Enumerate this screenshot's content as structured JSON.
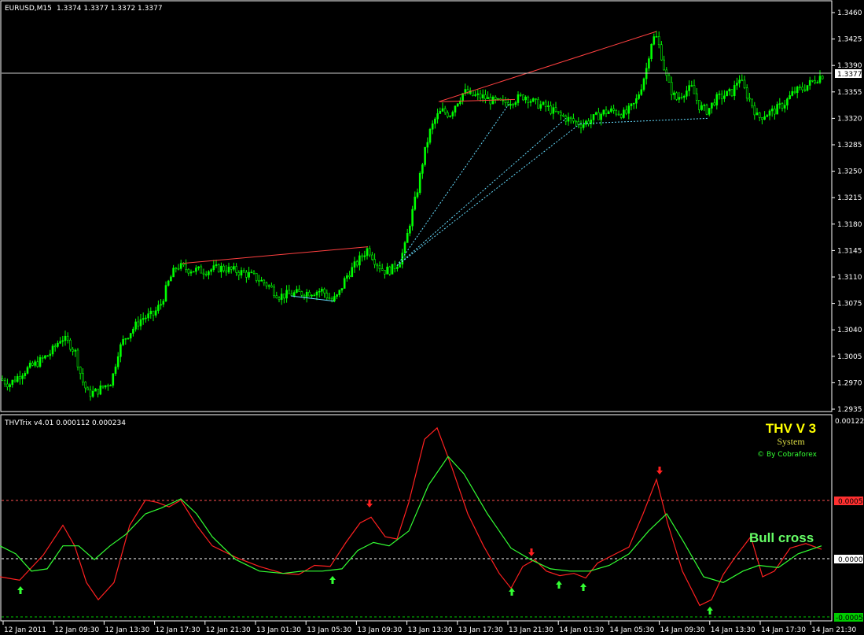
{
  "main": {
    "symbol_text": "EURUSD,M15",
    "ohlc_text": "1.3374 1.3377 1.3372 1.3377",
    "current_price": "1.3377",
    "price_ticks": [
      "1.3460",
      "1.3425",
      "1.3390",
      "1.3355",
      "1.3320",
      "1.3285",
      "1.3250",
      "1.3215",
      "1.3180",
      "1.3145",
      "1.3110",
      "1.3075",
      "1.3040",
      "1.3005",
      "1.2970",
      "1.2935"
    ]
  },
  "indicator": {
    "label": "THVTrix v4.01 0.000112 0.000234",
    "scale_top": "0.001224",
    "level_upper": "0.0005",
    "level_zero": "0.0000",
    "level_lower": "-0.0005",
    "brand_title": "THV V 3",
    "brand_sub": "System",
    "brand_credit": "© By Cobraforex",
    "annotation": "Bull cross"
  },
  "time_axis": [
    "12 Jan 2011",
    "12 Jan 09:30",
    "12 Jan 13:30",
    "12 Jan 17:30",
    "12 Jan 21:30",
    "13 Jan 01:30",
    "13 Jan 05:30",
    "13 Jan 09:30",
    "13 Jan 13:30",
    "13 Jan 17:30",
    "13 Jan 21:30",
    "14 Jan 01:30",
    "14 Jan 05:30",
    "14 Jan 09:30",
    "14 Jan 13:30",
    "14 Jan 17:30",
    "14 Jan 21:30"
  ],
  "colors": {
    "background": "#000000",
    "bull_candle": "#00ff00",
    "trix_fast": "#33ff33",
    "trix_slow": "#ff2020",
    "level_upper_badge": "#ff3030",
    "level_lower_badge": "#00cc00",
    "brand_title": "#ffff00",
    "annotation": "#66ff66"
  },
  "chart_data": [
    {
      "type": "candlestick",
      "title": "EURUSD,M15",
      "ylim": [
        1.2935,
        1.346
      ],
      "price_path": [
        [
          0,
          1.2975
        ],
        [
          12,
          1.2968
        ],
        [
          30,
          1.2985
        ],
        [
          50,
          1.2998
        ],
        [
          65,
          1.301
        ],
        [
          78,
          1.303
        ],
        [
          88,
          1.3022
        ],
        [
          96,
          1.301
        ],
        [
          104,
          1.2975
        ],
        [
          112,
          1.2955
        ],
        [
          122,
          1.2958
        ],
        [
          132,
          1.2965
        ],
        [
          142,
          1.2972
        ],
        [
          150,
          1.301
        ],
        [
          158,
          1.3028
        ],
        [
          168,
          1.304
        ],
        [
          180,
          1.3055
        ],
        [
          195,
          1.306
        ],
        [
          205,
          1.3075
        ],
        [
          215,
          1.3105
        ],
        [
          225,
          1.3125
        ],
        [
          240,
          1.312
        ],
        [
          260,
          1.3118
        ],
        [
          280,
          1.3122
        ],
        [
          300,
          1.3118
        ],
        [
          320,
          1.3112
        ],
        [
          340,
          1.31
        ],
        [
          355,
          1.3085
        ],
        [
          375,
          1.3088
        ],
        [
          395,
          1.309
        ],
        [
          410,
          1.3092
        ],
        [
          422,
          1.3078
        ],
        [
          430,
          1.3085
        ],
        [
          440,
          1.311
        ],
        [
          455,
          1.313
        ],
        [
          468,
          1.3148
        ],
        [
          478,
          1.313
        ],
        [
          488,
          1.3118
        ],
        [
          498,
          1.312
        ],
        [
          508,
          1.313
        ],
        [
          515,
          1.315
        ],
        [
          522,
          1.3185
        ],
        [
          530,
          1.322
        ],
        [
          538,
          1.3265
        ],
        [
          546,
          1.33
        ],
        [
          554,
          1.332
        ],
        [
          562,
          1.333
        ],
        [
          572,
          1.3325
        ],
        [
          580,
          1.334
        ],
        [
          590,
          1.3355
        ],
        [
          602,
          1.335
        ],
        [
          615,
          1.3348
        ],
        [
          628,
          1.3342
        ],
        [
          640,
          1.334
        ],
        [
          655,
          1.3345
        ],
        [
          668,
          1.335
        ],
        [
          680,
          1.334
        ],
        [
          695,
          1.3335
        ],
        [
          710,
          1.3325
        ],
        [
          725,
          1.3318
        ],
        [
          740,
          1.3312
        ],
        [
          755,
          1.332
        ],
        [
          768,
          1.3328
        ],
        [
          780,
          1.333
        ],
        [
          795,
          1.3325
        ],
        [
          808,
          1.334
        ],
        [
          815,
          1.336
        ],
        [
          822,
          1.3385
        ],
        [
          828,
          1.342
        ],
        [
          834,
          1.343
        ],
        [
          840,
          1.341
        ],
        [
          846,
          1.338
        ],
        [
          852,
          1.336
        ],
        [
          860,
          1.3345
        ],
        [
          870,
          1.3355
        ],
        [
          880,
          1.336
        ],
        [
          890,
          1.3335
        ],
        [
          900,
          1.333
        ],
        [
          910,
          1.3345
        ],
        [
          920,
          1.335
        ],
        [
          932,
          1.3355
        ],
        [
          940,
          1.3375
        ],
        [
          948,
          1.3355
        ],
        [
          956,
          1.334
        ],
        [
          964,
          1.332
        ],
        [
          972,
          1.3325
        ],
        [
          985,
          1.333
        ],
        [
          998,
          1.334
        ],
        [
          1010,
          1.3355
        ],
        [
          1022,
          1.336
        ],
        [
          1035,
          1.337
        ],
        [
          1045,
          1.3377
        ]
      ]
    },
    {
      "type": "line",
      "title": "THVTrix v4.01 0.000112 0.000234",
      "ylim": [
        -0.0005,
        0.001224
      ],
      "levels": [
        0.0005,
        0.0,
        -0.0005
      ],
      "series": [
        {
          "values_path": [
            [
              0,
              -0.00015
            ],
            [
              25,
              -0.00018
            ],
            [
              55,
              4e-05
            ],
            [
              80,
              0.0003
            ],
            [
              95,
              0.00012
            ],
            [
              110,
              -0.0002
            ],
            [
              125,
              -0.00035
            ],
            [
              145,
              -0.0002
            ],
            [
              165,
              0.0003
            ],
            [
              185,
              0.00052
            ],
            [
              200,
              0.0005
            ],
            [
              215,
              0.00046
            ],
            [
              230,
              0.00052
            ],
            [
              250,
              0.0003
            ],
            [
              270,
              0.00012
            ],
            [
              300,
              2e-05
            ],
            [
              330,
              -6e-05
            ],
            [
              360,
              -0.00012
            ],
            [
              380,
              -0.00013
            ],
            [
              400,
              -5e-05
            ],
            [
              420,
              -6e-05
            ],
            [
              440,
              0.00015
            ],
            [
              458,
              0.00032
            ],
            [
              472,
              0.00037
            ],
            [
              490,
              0.0002
            ],
            [
              505,
              0.00018
            ],
            [
              520,
              0.0005
            ],
            [
              540,
              0.00105
            ],
            [
              556,
              0.00115
            ],
            [
              575,
              0.0008
            ],
            [
              595,
              0.0004
            ],
            [
              615,
              0.00012
            ],
            [
              635,
              -0.00012
            ],
            [
              650,
              -0.00025
            ],
            [
              665,
              -6e-05
            ],
            [
              680,
              0.0
            ],
            [
              695,
              -0.0001
            ],
            [
              712,
              -0.00014
            ],
            [
              730,
              -0.00012
            ],
            [
              745,
              -0.00016
            ],
            [
              760,
              -3e-05
            ],
            [
              780,
              4e-05
            ],
            [
              800,
              0.00011
            ],
            [
              818,
              0.0004
            ],
            [
              835,
              0.0007
            ],
            [
              850,
              0.0003
            ],
            [
              868,
              -0.0001
            ],
            [
              890,
              -0.0004
            ],
            [
              905,
              -0.00035
            ],
            [
              920,
              -0.00013
            ],
            [
              935,
              2e-05
            ],
            [
              955,
              0.0002
            ],
            [
              970,
              -0.00015
            ],
            [
              985,
              -0.0001
            ],
            [
              1005,
              0.0001
            ],
            [
              1025,
              0.00014
            ],
            [
              1045,
              9e-05
            ]
          ]
        },
        {
          "values_path": [
            [
              0,
              0.00012
            ],
            [
              20,
              5e-05
            ],
            [
              40,
              -0.0001
            ],
            [
              60,
              -8e-05
            ],
            [
              80,
              0.00012
            ],
            [
              100,
              0.00012
            ],
            [
              120,
              0.0
            ],
            [
              140,
              0.00012
            ],
            [
              160,
              0.00022
            ],
            [
              185,
              0.0004
            ],
            [
              205,
              0.00045
            ],
            [
              230,
              0.00053
            ],
            [
              250,
              0.0004
            ],
            [
              270,
              0.0002
            ],
            [
              300,
              0.0
            ],
            [
              330,
              -0.0001
            ],
            [
              360,
              -0.00012
            ],
            [
              385,
              -0.0001
            ],
            [
              410,
              -0.0001
            ],
            [
              435,
              -8e-05
            ],
            [
              455,
              8e-05
            ],
            [
              475,
              0.00015
            ],
            [
              495,
              0.00012
            ],
            [
              520,
              0.00025
            ],
            [
              545,
              0.00065
            ],
            [
              570,
              0.0009
            ],
            [
              590,
              0.00075
            ],
            [
              620,
              0.0004
            ],
            [
              650,
              0.0001
            ],
            [
              675,
              0.0
            ],
            [
              700,
              -8e-05
            ],
            [
              725,
              -0.0001
            ],
            [
              750,
              -0.0001
            ],
            [
              775,
              -5e-05
            ],
            [
              800,
              5e-05
            ],
            [
              825,
              0.00025
            ],
            [
              848,
              0.0004
            ],
            [
              870,
              0.00015
            ],
            [
              895,
              -0.00015
            ],
            [
              920,
              -0.0002
            ],
            [
              945,
              -0.0001
            ],
            [
              965,
              -5e-05
            ],
            [
              990,
              -7e-05
            ],
            [
              1015,
              5e-05
            ],
            [
              1045,
              0.00012
            ]
          ]
        }
      ]
    }
  ]
}
